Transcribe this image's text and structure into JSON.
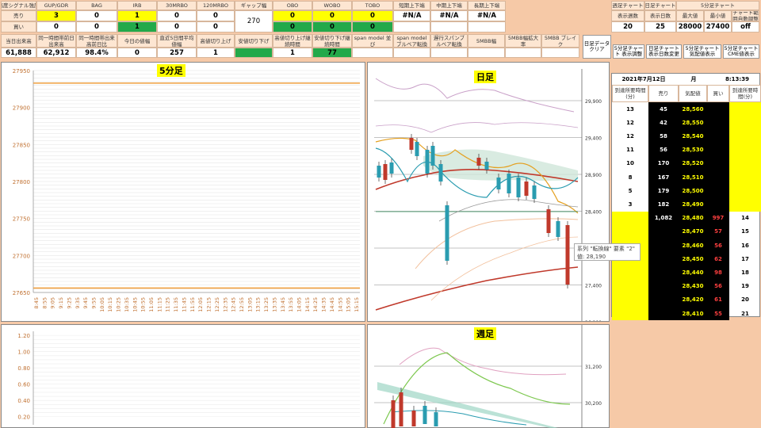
{
  "signals": {
    "headers": [
      "高度シグナル強度",
      "GUP/GDR",
      "BAG",
      "IRB",
      "30MRBO",
      "120MRBO",
      "ギャップ幅",
      "OBO",
      "WOBO",
      "TOBO",
      "短期上下端",
      "中期上下端",
      "長期上下端"
    ],
    "sell_label": "売り",
    "buy_label": "買い",
    "sell_values": [
      "3",
      "0",
      "1",
      "0",
      "0",
      "0",
      "0",
      "0"
    ],
    "buy_values": [
      "0",
      "0",
      "1",
      "0",
      "0",
      "0",
      "0",
      "0"
    ],
    "gap_value": "270",
    "na_values": [
      "#N/A",
      "#N/A",
      "#N/A"
    ]
  },
  "stats": {
    "headers": [
      "当日出来高",
      "同一時間帯前日出来高",
      "同一時間帯出来高前日比",
      "今日の値幅",
      "直近5日間平均値幅",
      "高値切り上げ",
      "安値切り下げ",
      "高値切り上げ継続時間",
      "安値切り下げ継続時間",
      "span model 並び",
      "span model ブルベア転換",
      "遅行スパンブルベア転換",
      "5MBB幅",
      "5MBB幅拡大率",
      "5MBB ブレイク"
    ],
    "values": [
      "61,888",
      "62,912",
      "98.4%",
      "0",
      "257",
      "1",
      "",
      "1",
      "77",
      "",
      "",
      "",
      "",
      "",
      ""
    ]
  },
  "right_top": {
    "weekly_label": "週足チャート",
    "daily_label": "日足チャート",
    "fivemin_label": "5分足チャート",
    "headers": [
      "表示週数",
      "表示日数",
      "最大値",
      "最小値",
      "チャート範囲自動調整"
    ],
    "values": [
      "20",
      "25",
      "28000",
      "27400",
      "off"
    ]
  },
  "buttons": {
    "clear": "日足データ クリア",
    "b1": "5分足チャート 表示調整",
    "b2": "日足チャート 表示日数変更",
    "b3": "5分足チャート 気配値表示",
    "b4": "5分足チャート CME値表示"
  },
  "orderbook": {
    "date": "2021年7月12日",
    "weekday": "月",
    "time": "8:13:39",
    "col_headers": [
      "到達所要時間(分)",
      "売り",
      "気配値",
      "買い",
      "到達所要時間(分)"
    ],
    "sell_rows": [
      {
        "t": "13",
        "sell": "45",
        "price": "28,560"
      },
      {
        "t": "12",
        "sell": "42",
        "price": "28,550"
      },
      {
        "t": "12",
        "sell": "58",
        "price": "28,540"
      },
      {
        "t": "11",
        "sell": "56",
        "price": "28,530"
      },
      {
        "t": "10",
        "sell": "170",
        "price": "28,520"
      },
      {
        "t": "8",
        "sell": "167",
        "price": "28,510"
      },
      {
        "t": "5",
        "sell": "179",
        "price": "28,500"
      },
      {
        "t": "3",
        "sell": "182",
        "price": "28,490"
      }
    ],
    "buy_rows": [
      {
        "sell": "1,082",
        "price": "28,480",
        "buy": "997",
        "t": "14"
      },
      {
        "price": "28,470",
        "buy": "57",
        "t": "15"
      },
      {
        "price": "28,460",
        "buy": "56",
        "t": "16"
      },
      {
        "price": "28,450",
        "buy": "62",
        "t": "17"
      },
      {
        "price": "28,440",
        "buy": "98",
        "t": "18"
      },
      {
        "price": "28,430",
        "buy": "56",
        "t": "19"
      },
      {
        "price": "28,420",
        "buy": "61",
        "t": "20"
      },
      {
        "price": "28,410",
        "buy": "55",
        "t": "21"
      }
    ]
  },
  "chart_data": [
    {
      "type": "line",
      "title": "5分足",
      "yticks": [
        "27950",
        "27900",
        "27850",
        "27800",
        "27750",
        "27700",
        "27650"
      ],
      "ylim": [
        27650,
        27950
      ],
      "hlines": [
        {
          "y": 27933,
          "color": "#f0a040"
        },
        {
          "y": 27656,
          "color": "#f0a040"
        }
      ],
      "x": [
        "8:45",
        "8:55",
        "9:05",
        "9:15",
        "9:25",
        "9:35",
        "9:45",
        "9:55",
        "10:05",
        "10:15",
        "10:25",
        "10:35",
        "10:45",
        "10:55",
        "11:05",
        "11:15",
        "11:25",
        "11:35",
        "11:45",
        "11:55",
        "12:05",
        "12:15",
        "12:25",
        "12:35",
        "12:45",
        "12:55",
        "13:05",
        "13:15",
        "13:25",
        "13:35",
        "13:45",
        "13:55",
        "14:05",
        "14:15",
        "14:25",
        "14:35",
        "14:45",
        "14:55",
        "15:05",
        "15:15"
      ]
    },
    {
      "type": "line",
      "yticks": [
        "1.20",
        "1.00",
        "0.80",
        "0.60",
        "0.40",
        "0.20"
      ],
      "ylim": [
        0.1,
        1.25
      ]
    },
    {
      "type": "line",
      "title": "日足",
      "yticks": [
        "29,900",
        "29,400",
        "28,900",
        "28,400",
        "27,900",
        "27,400",
        "26,900"
      ],
      "tooltip": [
        "系列 \"転換線\" 要素 \"2\"",
        "値: 28,190"
      ]
    },
    {
      "type": "line",
      "title": "週足",
      "yticks": [
        "31,200",
        "30,200"
      ]
    }
  ]
}
